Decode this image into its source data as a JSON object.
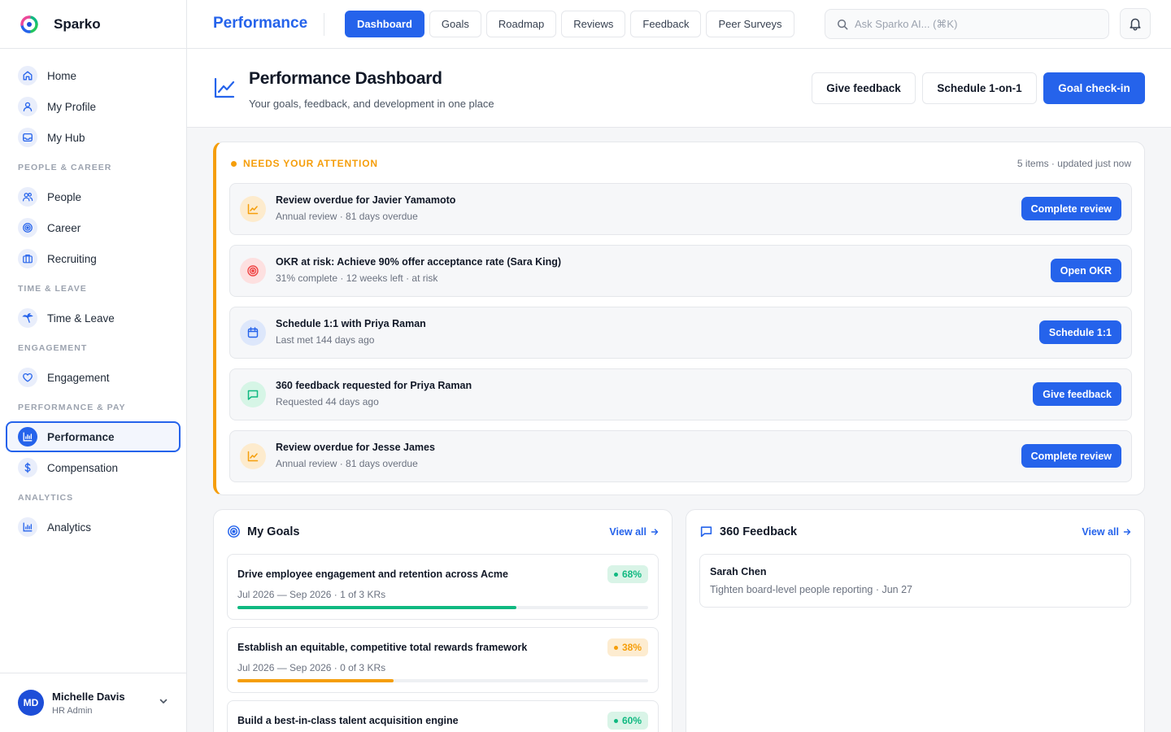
{
  "app": {
    "name": "Sparko"
  },
  "sidebar": {
    "items": [
      {
        "label": "Home",
        "icon": "home-icon"
      },
      {
        "label": "My Profile",
        "icon": "user-icon"
      },
      {
        "label": "My Hub",
        "icon": "inbox-icon"
      }
    ],
    "sections": [
      {
        "title": "PEOPLE & CAREER",
        "items": [
          {
            "label": "People",
            "icon": "users-icon"
          },
          {
            "label": "Career",
            "icon": "target-icon"
          },
          {
            "label": "Recruiting",
            "icon": "briefcase-icon"
          }
        ]
      },
      {
        "title": "TIME & LEAVE",
        "items": [
          {
            "label": "Time & Leave",
            "icon": "palm-tree-icon"
          }
        ]
      },
      {
        "title": "ENGAGEMENT",
        "items": [
          {
            "label": "Engagement",
            "icon": "heart-icon"
          }
        ]
      },
      {
        "title": "PERFORMANCE & PAY",
        "items": [
          {
            "label": "Performance",
            "icon": "bar-chart-icon",
            "active": true
          },
          {
            "label": "Compensation",
            "icon": "dollar-icon"
          }
        ]
      },
      {
        "title": "ANALYTICS",
        "items": [
          {
            "label": "Analytics",
            "icon": "bar-chart-icon"
          }
        ]
      }
    ],
    "user": {
      "initials": "MD",
      "name": "Michelle Davis",
      "role": "HR Admin"
    }
  },
  "topbar": {
    "title": "Performance",
    "tabs": [
      "Dashboard",
      "Goals",
      "Roadmap",
      "Reviews",
      "Feedback",
      "Peer Surveys"
    ],
    "active_tab": "Dashboard",
    "search_placeholder": "Ask Sparko AI... (⌘K)"
  },
  "header": {
    "title": "Performance Dashboard",
    "subtitle": "Your goals, feedback, and development in one place",
    "actions": {
      "give_feedback": "Give feedback",
      "schedule": "Schedule 1-on-1",
      "checkin": "Goal check-in"
    }
  },
  "attention": {
    "heading": "NEEDS YOUR ATTENTION",
    "meta": "5 items · updated just now",
    "items": [
      {
        "title": "Review overdue for Javier Yamamoto",
        "subtitle": "Annual review · 81 days overdue",
        "action": "Complete review",
        "icon": "trend-chart-icon",
        "tone": "amber"
      },
      {
        "title": "OKR at risk: Achieve 90% offer acceptance rate (Sara King)",
        "subtitle": "31% complete · 12 weeks left · at risk",
        "action": "Open OKR",
        "icon": "target-icon",
        "tone": "red"
      },
      {
        "title": "Schedule 1:1 with Priya Raman",
        "subtitle": "Last met 144 days ago",
        "action": "Schedule 1:1",
        "icon": "calendar-icon",
        "tone": "blue"
      },
      {
        "title": "360 feedback requested for Priya Raman",
        "subtitle": "Requested 44 days ago",
        "action": "Give feedback",
        "icon": "message-icon",
        "tone": "green"
      },
      {
        "title": "Review overdue for Jesse James",
        "subtitle": "Annual review · 81 days overdue",
        "action": "Complete review",
        "icon": "trend-chart-icon",
        "tone": "amber"
      }
    ]
  },
  "goals": {
    "title": "My Goals",
    "view_all": "View all",
    "items": [
      {
        "title": "Drive employee engagement and retention across Acme",
        "meta": "Jul 2026 — Sep 2026 · 1 of 3 KRs",
        "percent": "68%",
        "progress": 0.68,
        "tone": "green"
      },
      {
        "title": "Establish an equitable, competitive total rewards framework",
        "meta": "Jul 2026 — Sep 2026 · 0 of 3 KRs",
        "percent": "38%",
        "progress": 0.38,
        "tone": "amber"
      },
      {
        "title": "Build a best-in-class talent acquisition engine",
        "meta": "",
        "percent": "60%",
        "progress": 0.6,
        "tone": "green"
      }
    ]
  },
  "feedback": {
    "title": "360 Feedback",
    "view_all": "View all",
    "items": [
      {
        "name": "Sarah Chen",
        "subtitle": "Tighten board-level people reporting · Jun 27"
      }
    ]
  },
  "colors": {
    "accent": "#2563eb",
    "amber": "#f59e0b",
    "green": "#10b981",
    "red": "#ef4444"
  }
}
